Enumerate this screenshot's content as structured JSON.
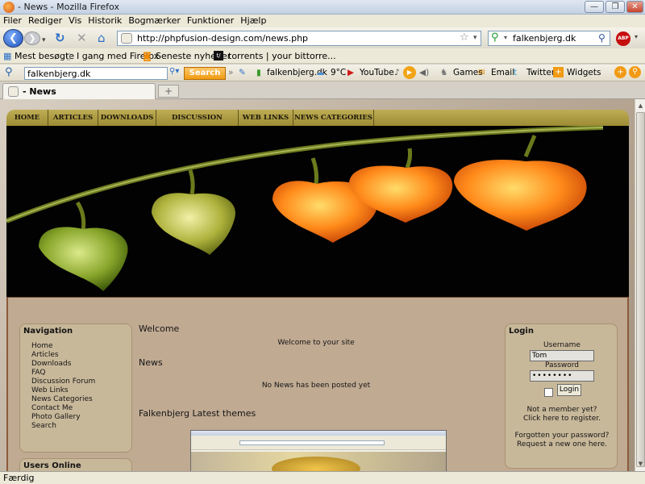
{
  "window": {
    "title": " - News - Mozilla Firefox"
  },
  "menu": [
    "Filer",
    "Rediger",
    "Vis",
    "Historik",
    "Bogmærker",
    "Funktioner",
    "Hjælp"
  ],
  "navbar": {
    "url": "http://phpfusion-design.com/news.php",
    "search_value": "falkenbjerg.dk"
  },
  "bookmarks": [
    "Mest besøgte",
    "I gang med Firefox",
    "Seneste nyheder",
    "torrents | your bittorre..."
  ],
  "toolbar2": {
    "search_value": "falkenbjerg.dk",
    "search_label": "Search",
    "site_label": "falkenbjerg.dk",
    "weather": "9°C",
    "youtube": "YouTube",
    "games": "Games",
    "email": "Email",
    "twitter": "Twitter",
    "widgets": "Widgets"
  },
  "tab": {
    "title": " - News"
  },
  "site": {
    "nav": [
      "HOME",
      "ARTICLES",
      "DOWNLOADS",
      "DISCUSSION FORUM",
      "WEB LINKS",
      "NEWS CATEGORIES"
    ],
    "navigation": {
      "title": "Navigation",
      "items": [
        "Home",
        "Articles",
        "Downloads",
        "FAQ",
        "Discussion Forum",
        "Web Links",
        "News Categories",
        "Contact Me",
        "Photo Gallery",
        "Search"
      ]
    },
    "users_online": {
      "title": "Users Online"
    },
    "welcome": {
      "heading": "Welcome",
      "text": "Welcome to your site"
    },
    "news": {
      "heading": "News",
      "text": "No News has been posted yet"
    },
    "themes": {
      "heading": "Falkenbjerg Latest themes"
    },
    "login": {
      "title": "Login",
      "username_label": "Username",
      "username_value": "Tom",
      "password_label": "Password",
      "password_value": "••••••••",
      "button": "Login",
      "member_line1": "Not a member yet?",
      "member_line2": "Click here to register.",
      "forgot_line1": "Forgotten your password?",
      "forgot_line2": "Request a new one here."
    }
  },
  "status": {
    "text": "Færdig"
  }
}
